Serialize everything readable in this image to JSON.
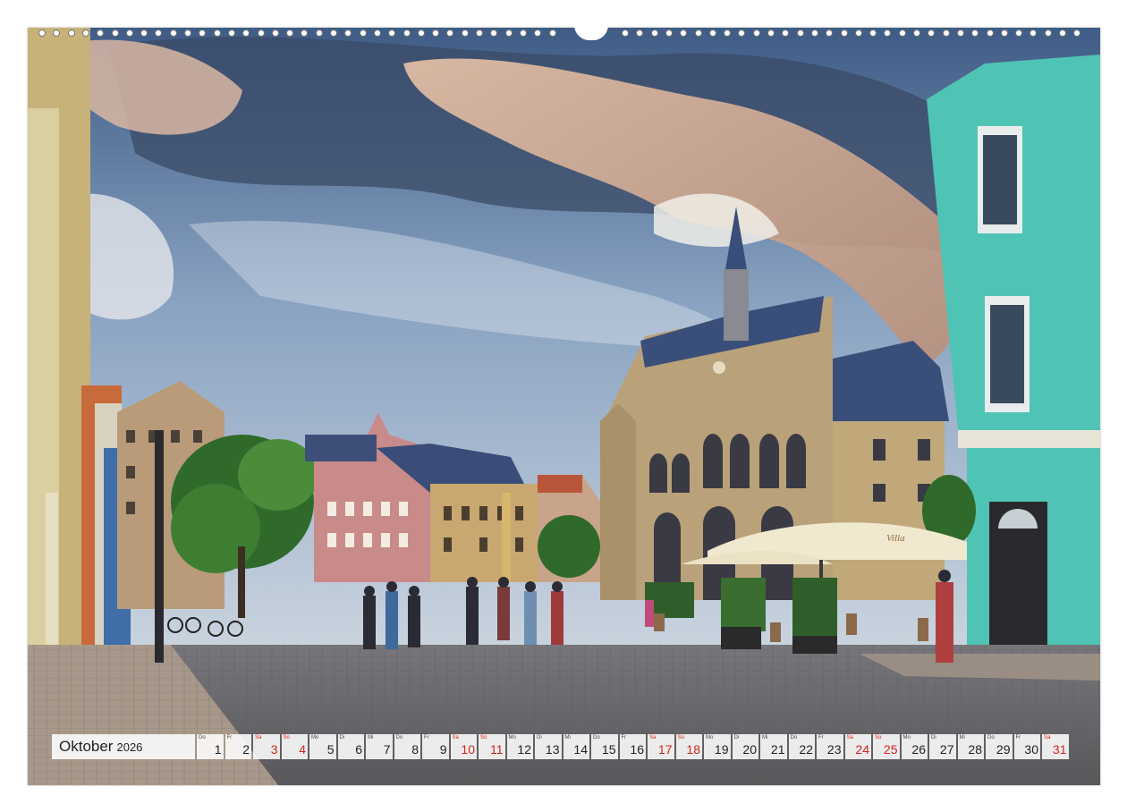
{
  "calendar": {
    "month": "Oktober",
    "year": "2026",
    "days": [
      {
        "num": "1",
        "wd": "Do",
        "weekend": false
      },
      {
        "num": "2",
        "wd": "Fr",
        "weekend": false
      },
      {
        "num": "3",
        "wd": "Sa",
        "weekend": true
      },
      {
        "num": "4",
        "wd": "So",
        "weekend": true
      },
      {
        "num": "5",
        "wd": "Mo",
        "weekend": false
      },
      {
        "num": "6",
        "wd": "Di",
        "weekend": false
      },
      {
        "num": "7",
        "wd": "Mi",
        "weekend": false
      },
      {
        "num": "8",
        "wd": "Do",
        "weekend": false
      },
      {
        "num": "9",
        "wd": "Fr",
        "weekend": false
      },
      {
        "num": "10",
        "wd": "Sa",
        "weekend": true
      },
      {
        "num": "11",
        "wd": "So",
        "weekend": true
      },
      {
        "num": "12",
        "wd": "Mo",
        "weekend": false
      },
      {
        "num": "13",
        "wd": "Di",
        "weekend": false
      },
      {
        "num": "14",
        "wd": "Mi",
        "weekend": false
      },
      {
        "num": "15",
        "wd": "Do",
        "weekend": false
      },
      {
        "num": "16",
        "wd": "Fr",
        "weekend": false
      },
      {
        "num": "17",
        "wd": "Sa",
        "weekend": true
      },
      {
        "num": "18",
        "wd": "So",
        "weekend": true
      },
      {
        "num": "19",
        "wd": "Mo",
        "weekend": false
      },
      {
        "num": "20",
        "wd": "Di",
        "weekend": false
      },
      {
        "num": "21",
        "wd": "Mi",
        "weekend": false
      },
      {
        "num": "22",
        "wd": "Do",
        "weekend": false
      },
      {
        "num": "23",
        "wd": "Fr",
        "weekend": false
      },
      {
        "num": "24",
        "wd": "Sa",
        "weekend": true
      },
      {
        "num": "25",
        "wd": "So",
        "weekend": true
      },
      {
        "num": "26",
        "wd": "Mo",
        "weekend": false
      },
      {
        "num": "27",
        "wd": "Di",
        "weekend": false
      },
      {
        "num": "28",
        "wd": "Mi",
        "weekend": false
      },
      {
        "num": "29",
        "wd": "Do",
        "weekend": false
      },
      {
        "num": "30",
        "wd": "Fr",
        "weekend": false
      },
      {
        "num": "31",
        "wd": "Sa",
        "weekend": true
      }
    ]
  },
  "colors": {
    "weekend": "#d1261c",
    "sky_top": "#4a6a93",
    "cobblestone": "#6b6a6c",
    "townhall_stone": "#b9a27a",
    "teal_house": "#4fc4b4"
  },
  "photo": {
    "umbrella_text": "Villa"
  }
}
